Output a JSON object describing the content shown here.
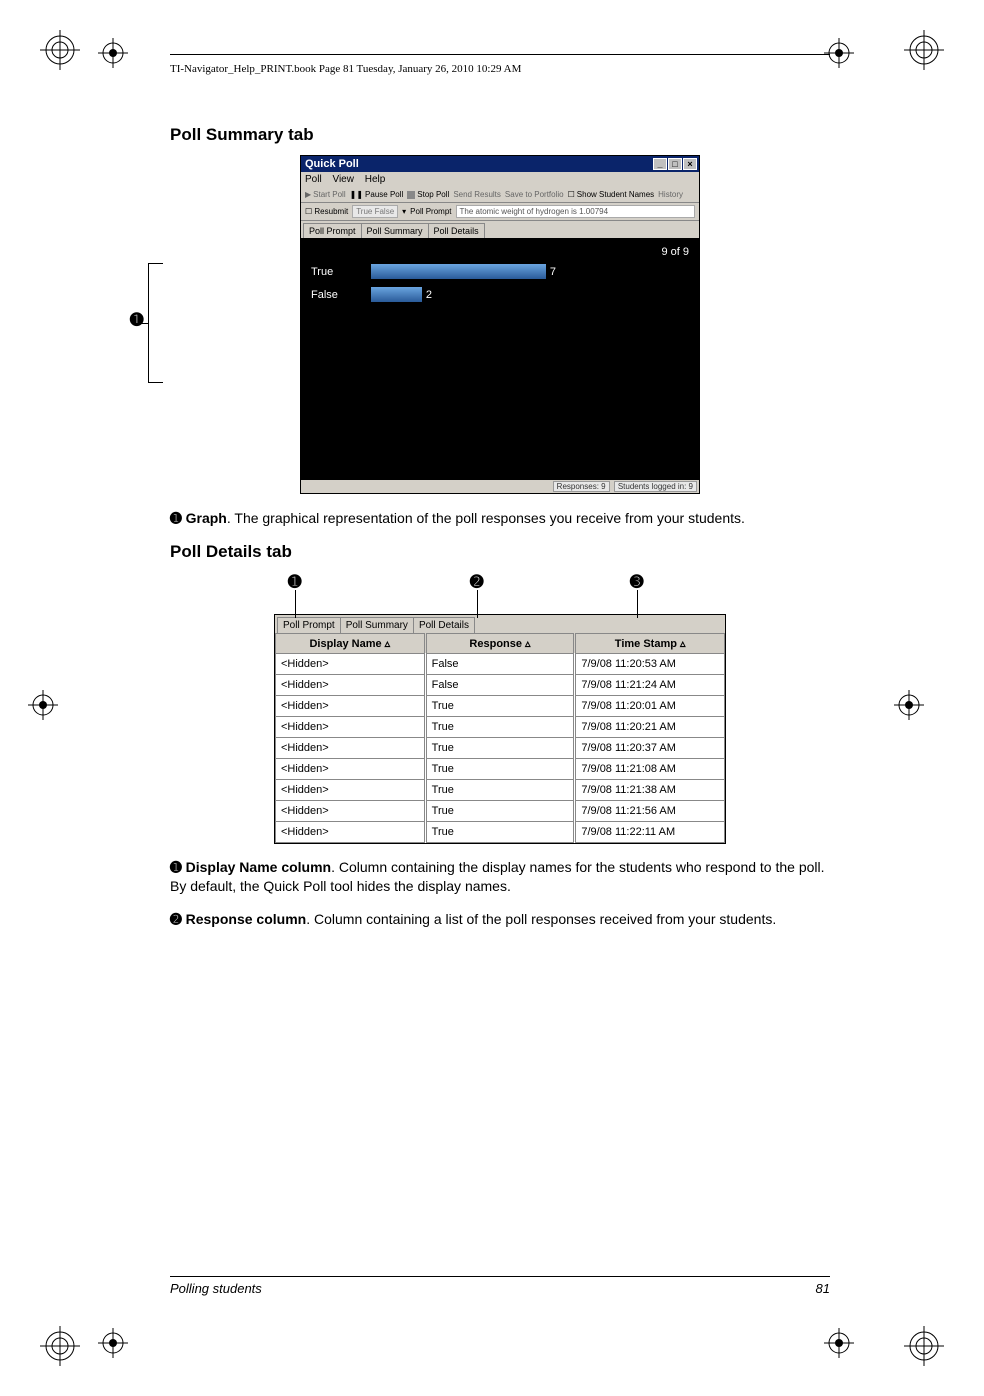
{
  "book_meta": "TI-Navigator_Help_PRINT.book  Page 81  Tuesday, January 26, 2010  10:29 AM",
  "section1_title": "Poll Summary tab",
  "section2_title": "Poll Details tab",
  "callout_label_1": "➊",
  "graph_text_lead": "➊ Graph",
  "graph_text_body": ". The graphical representation of the poll responses you receive from your students.",
  "display_col_lead": "➊ Display Name column",
  "display_col_body": ". Column containing the display names for the students who respond to the poll. By default, the Quick Poll tool hides the display names.",
  "response_col_lead": "➋ Response column",
  "response_col_body": ". Column containing a list of the poll responses received from your students.",
  "qp": {
    "title": "Quick Poll",
    "menus": [
      "Poll",
      "View",
      "Help"
    ],
    "toolbar": {
      "start": "Start Poll",
      "pause": "Pause Poll",
      "stop": "Stop Poll",
      "send": "Send Results",
      "save": "Save to Portfolio",
      "showNames": "Show Student Names",
      "history": "History"
    },
    "row2": {
      "resubmit_label": "Resubmit",
      "type_value": "True False",
      "prompt_label": "Poll Prompt",
      "prompt_value": "The atomic weight of hydrogen is 1.00794"
    },
    "tabs": [
      "Poll Prompt",
      "Poll Summary",
      "Poll Details"
    ],
    "active_tab": "Poll Summary",
    "counter": "9 of 9",
    "status": {
      "responses": "Responses: 9",
      "logged": "Students logged in: 9"
    }
  },
  "chart_data": {
    "type": "bar",
    "orientation": "horizontal",
    "categories": [
      "True",
      "False"
    ],
    "values": [
      7,
      2
    ],
    "title": "",
    "xlabel": "",
    "ylabel": "",
    "xlim": [
      0,
      9
    ]
  },
  "details": {
    "tabs": [
      "Poll Prompt",
      "Poll Summary",
      "Poll Details"
    ],
    "active_tab": "Poll Details",
    "callouts": {
      "c1": "➊",
      "c2": "➋",
      "c3": "➌"
    },
    "headers": [
      "Display Name ▵",
      "Response ▵",
      "Time Stamp ▵"
    ],
    "rows": [
      {
        "name": "<Hidden>",
        "response": "False",
        "ts": "7/9/08 11:20:53 AM"
      },
      {
        "name": "<Hidden>",
        "response": "False",
        "ts": "7/9/08 11:21:24 AM"
      },
      {
        "name": "<Hidden>",
        "response": "True",
        "ts": "7/9/08 11:20:01 AM"
      },
      {
        "name": "<Hidden>",
        "response": "True",
        "ts": "7/9/08 11:20:21 AM"
      },
      {
        "name": "<Hidden>",
        "response": "True",
        "ts": "7/9/08 11:20:37 AM"
      },
      {
        "name": "<Hidden>",
        "response": "True",
        "ts": "7/9/08 11:21:08 AM"
      },
      {
        "name": "<Hidden>",
        "response": "True",
        "ts": "7/9/08 11:21:38 AM"
      },
      {
        "name": "<Hidden>",
        "response": "True",
        "ts": "7/9/08 11:21:56 AM"
      },
      {
        "name": "<Hidden>",
        "response": "True",
        "ts": "7/9/08 11:22:11 AM"
      }
    ]
  },
  "footer": {
    "section": "Polling students",
    "page": "81"
  }
}
